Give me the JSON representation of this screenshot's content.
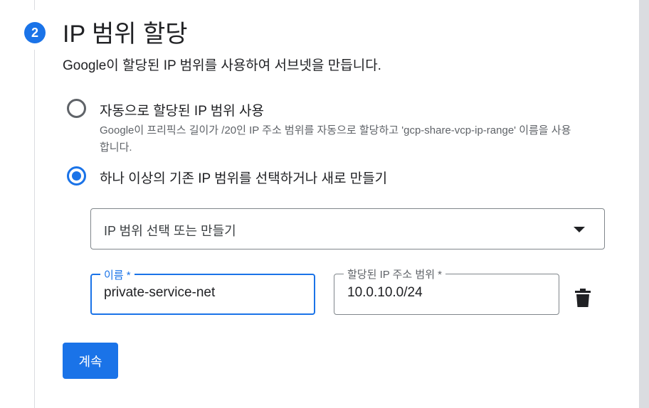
{
  "step": {
    "number": "2",
    "title": "IP 범위 할당",
    "description": "Google이 할당된 IP 범위를 사용하여 서브넷을 만듭니다."
  },
  "options": [
    {
      "label": "자동으로 할당된 IP 범위 사용",
      "help": "Google이 프리픽스 길이가 /20인 IP 주소 범위를 자동으로 할당하고 'gcp-share-vcp-ip-range' 이름을 사용합니다.",
      "selected": false
    },
    {
      "label": "하나 이상의 기존 IP 범위를 선택하거나 새로 만들기",
      "selected": true
    }
  ],
  "range_select": {
    "placeholder": "IP 범위 선택 또는 만들기"
  },
  "name_field": {
    "label": "이름 *",
    "value": "private-service-net"
  },
  "range_field": {
    "label": "할당된 IP 주소 범위 *",
    "value": "10.0.10.0/24"
  },
  "icons": {
    "delete": "trash-icon",
    "dropdown": "dropdown-arrow-icon"
  },
  "continue_label": "계속",
  "colors": {
    "accent": "#1a73e8",
    "text": "#202124",
    "muted": "#5f6368",
    "border": "#80868b",
    "rail": "#dadce0"
  }
}
